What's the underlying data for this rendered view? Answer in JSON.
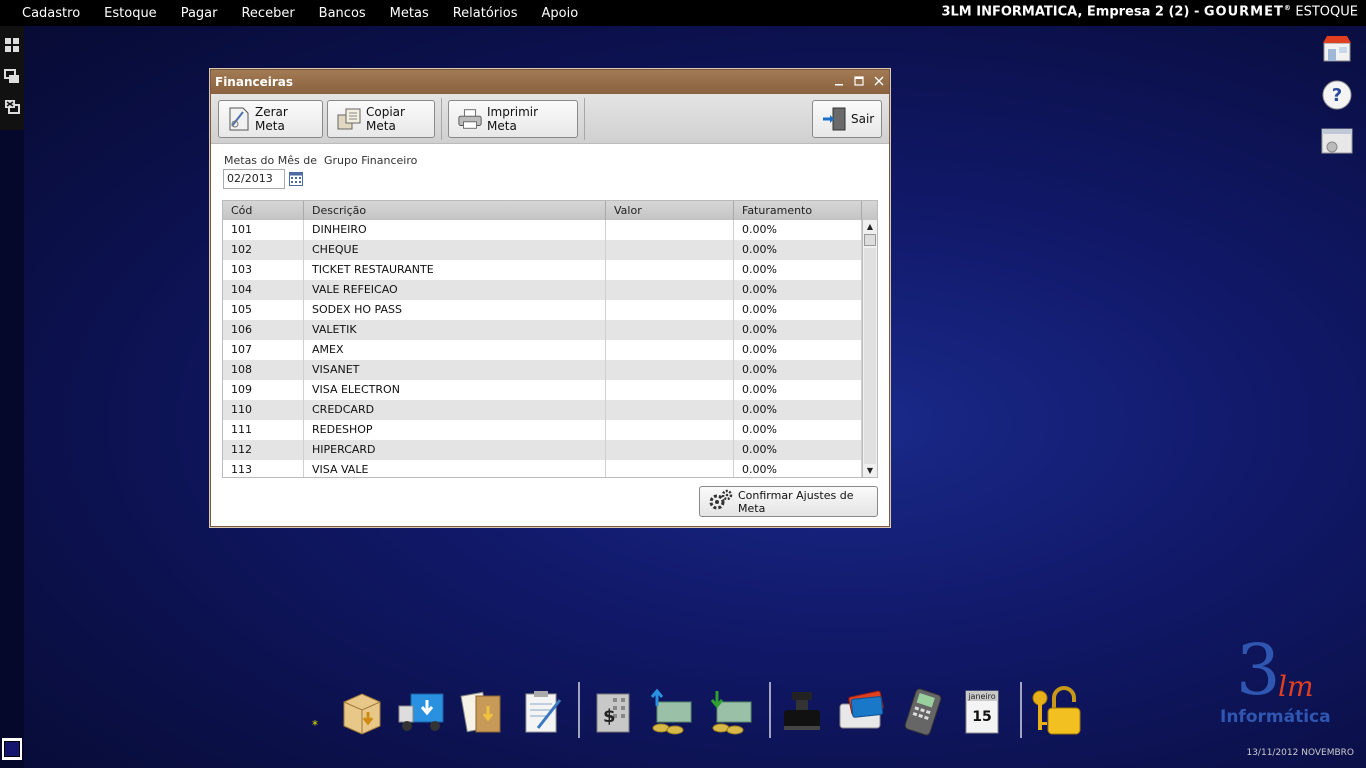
{
  "menubar": {
    "items": [
      "Cadastro",
      "Estoque",
      "Pagar",
      "Receber",
      "Bancos",
      "Metas",
      "Relatórios",
      "Apoio"
    ],
    "company": "3LM INFORMATICA,  Empresa 2 (2) - ",
    "brand": "GOURMET",
    "registered": "®",
    "product": "ESTOQUE"
  },
  "window": {
    "title": "Financeiras",
    "toolbar": {
      "zerar": "Zerar Meta",
      "copiar": "Copiar Meta",
      "imprimir": "Imprimir Meta",
      "sair": "Sair"
    },
    "filters": {
      "month_label": "Metas do Mês de",
      "group_label": "Grupo Financeiro",
      "month_value": "02/2013"
    },
    "table": {
      "headers": [
        "Cód",
        "Descrição",
        "Valor",
        "Faturamento"
      ],
      "rows": [
        {
          "cod": "101",
          "desc": "DINHEIRO",
          "valor": "",
          "fat": "0.00%"
        },
        {
          "cod": "102",
          "desc": "CHEQUE",
          "valor": "",
          "fat": "0.00%"
        },
        {
          "cod": "103",
          "desc": "TICKET RESTAURANTE",
          "valor": "",
          "fat": "0.00%"
        },
        {
          "cod": "104",
          "desc": "VALE REFEICAO",
          "valor": "",
          "fat": "0.00%"
        },
        {
          "cod": "105",
          "desc": "SODEX HO PASS",
          "valor": "",
          "fat": "0.00%"
        },
        {
          "cod": "106",
          "desc": "VALETIK",
          "valor": "",
          "fat": "0.00%"
        },
        {
          "cod": "107",
          "desc": "AMEX",
          "valor": "",
          "fat": "0.00%"
        },
        {
          "cod": "108",
          "desc": "VISANET",
          "valor": "",
          "fat": "0.00%"
        },
        {
          "cod": "109",
          "desc": "VISA ELECTRON",
          "valor": "",
          "fat": "0.00%"
        },
        {
          "cod": "110",
          "desc": "CREDCARD",
          "valor": "",
          "fat": "0.00%"
        },
        {
          "cod": "111",
          "desc": "REDESHOP",
          "valor": "",
          "fat": "0.00%"
        },
        {
          "cod": "112",
          "desc": "HIPERCARD",
          "valor": "",
          "fat": "0.00%"
        },
        {
          "cod": "113",
          "desc": "VISA VALE",
          "valor": "",
          "fat": "0.00%"
        }
      ]
    },
    "confirm_label": "Confirmar Ajustes de Meta"
  },
  "dock": {
    "asterisk": "*",
    "calendar_month": "janeiro",
    "calendar_day": "15"
  },
  "logo": {
    "mark": "3",
    "script": "lm",
    "name": "Informática"
  },
  "footer": {
    "date": "13/11/2012 NOVEMBRO"
  },
  "colors": {
    "title_brown": "#8a6240",
    "desktop": "#11196a",
    "logo_blue": "#2f56b0"
  }
}
